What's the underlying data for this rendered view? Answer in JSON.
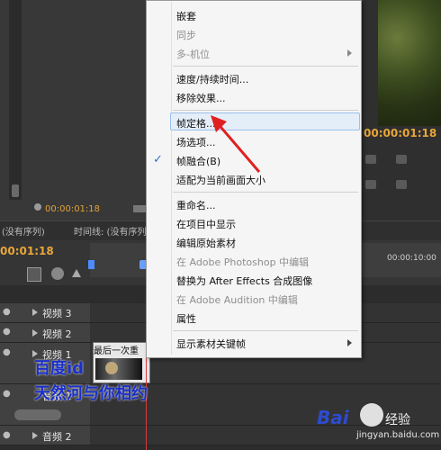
{
  "source_monitor": {
    "timecode": "00:00:01:18"
  },
  "program_monitor": {
    "timecode": "00:00:01:18"
  },
  "tabs": {
    "sequence": "(没有序列)",
    "timeline": "时间线: (没有序列"
  },
  "timeline": {
    "timecode": "00:01:18",
    "ruler_label": "00:00:10:00"
  },
  "tracks": [
    {
      "label": "视频 3"
    },
    {
      "label": "视频 2"
    },
    {
      "label": "视频 1"
    },
    {
      "label": "音频 1"
    },
    {
      "label": "音频 2"
    }
  ],
  "clip": {
    "title": "最后一次重"
  },
  "overlay_text": {
    "line1": "百度id",
    "line2": "天然河与你相约"
  },
  "context_menu": {
    "items": [
      {
        "label": "嵌套",
        "enabled": true
      },
      {
        "label": "同步",
        "enabled": false
      },
      {
        "label": "多-机位",
        "enabled": false,
        "submenu": true
      },
      {
        "label": "速度/持续时间...",
        "enabled": true
      },
      {
        "label": "移除效果...",
        "enabled": true
      },
      {
        "label": "帧定格...",
        "enabled": true,
        "highlighted": true
      },
      {
        "label": "场选项...",
        "enabled": true
      },
      {
        "label": "帧融合(B)",
        "enabled": true,
        "checked": true
      },
      {
        "label": "适配为当前画面大小",
        "enabled": true
      },
      {
        "label": "重命名...",
        "enabled": true
      },
      {
        "label": "在项目中显示",
        "enabled": true
      },
      {
        "label": "编辑原始素材",
        "enabled": true
      },
      {
        "label": "在 Adobe Photoshop 中编辑",
        "enabled": false
      },
      {
        "label": "替换为 After Effects 合成图像",
        "enabled": true
      },
      {
        "label": "在 Adobe Audition 中编辑",
        "enabled": false
      },
      {
        "label": "属性",
        "enabled": true
      },
      {
        "label": "显示素材关键帧",
        "enabled": true,
        "submenu": true
      }
    ]
  },
  "watermark": {
    "brand": "Bai",
    "brand2": "经验",
    "url": "jingyan.baidu.com"
  },
  "colors": {
    "accent_timecode": "#e8a63a",
    "annotation": "#e02020",
    "highlight": "#e4eef9"
  }
}
